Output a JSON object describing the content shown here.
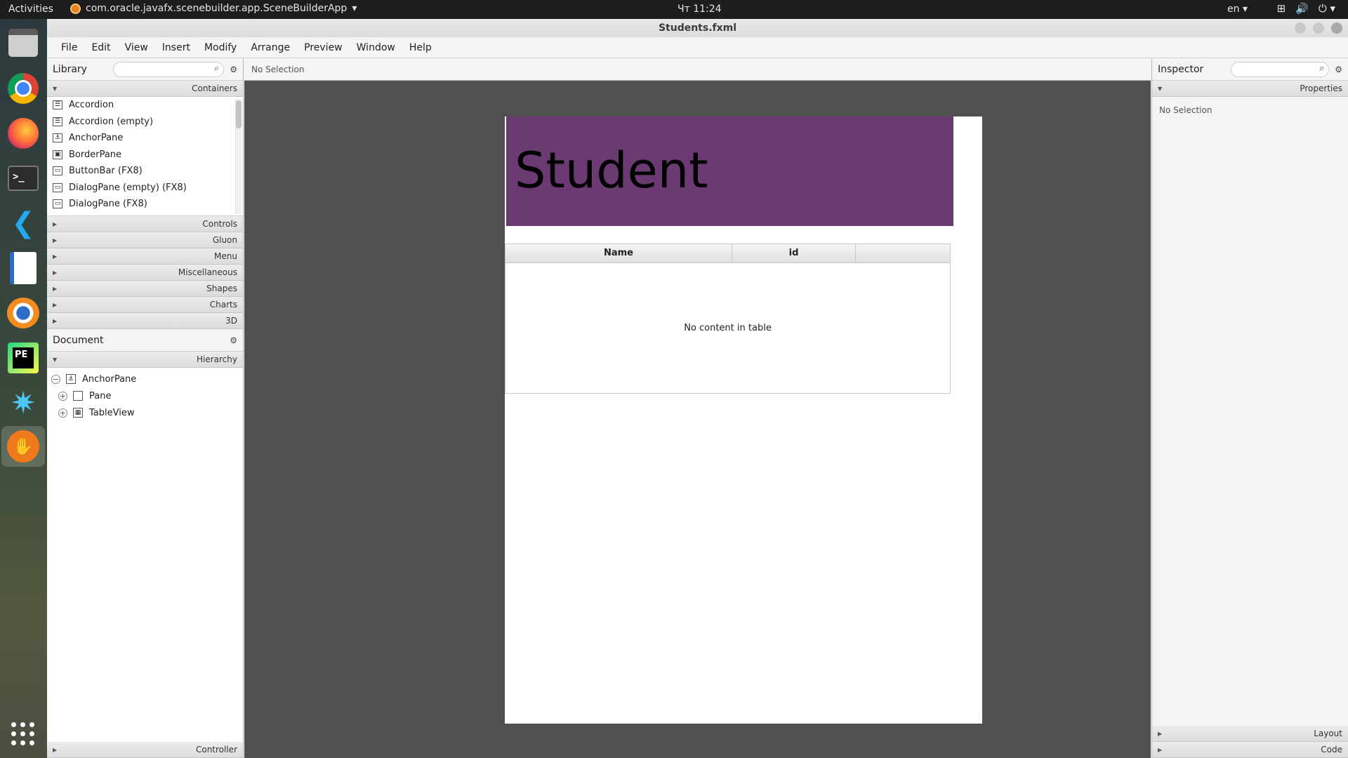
{
  "topbar": {
    "activities": "Activities",
    "app_name": "com.oracle.javafx.scenebuilder.app.SceneBuilderApp",
    "clock": "Чт 11:24",
    "language": "en"
  },
  "dock": {
    "items": [
      "files-icon",
      "chrome-icon",
      "firefox-icon",
      "terminal-icon",
      "vscode-icon",
      "writer-icon",
      "blender-icon",
      "pycharm-icon",
      "splash-icon",
      "scenebuilder-icon",
      "apps-grid-icon"
    ]
  },
  "window": {
    "title": "Students.fxml"
  },
  "menubar": [
    "File",
    "Edit",
    "View",
    "Insert",
    "Modify",
    "Arrange",
    "Preview",
    "Window",
    "Help"
  ],
  "library": {
    "title": "Library",
    "containers_label": "Containers",
    "items": [
      "Accordion",
      "Accordion  (empty)",
      "AnchorPane",
      "BorderPane",
      "ButtonBar  (FX8)",
      "DialogPane (empty)  (FX8)",
      "DialogPane  (FX8)"
    ],
    "sections": [
      "Controls",
      "Gluon",
      "Menu",
      "Miscellaneous",
      "Shapes",
      "Charts",
      "3D"
    ]
  },
  "document": {
    "title": "Document",
    "hierarchy_label": "Hierarchy",
    "tree": {
      "root": "AnchorPane",
      "children": [
        "Pane",
        "TableView"
      ]
    },
    "controller_label": "Controller"
  },
  "center": {
    "selection_text": "No Selection",
    "header_text": "Student",
    "table": {
      "columns": [
        "Name",
        "id"
      ],
      "placeholder": "No content in table"
    }
  },
  "inspector": {
    "title": "Inspector",
    "properties_label": "Properties",
    "selection_text": "No Selection",
    "layout_label": "Layout",
    "code_label": "Code"
  },
  "colors": {
    "header_pane": "#6b3a73",
    "canvas_bg": "#4f4f4f"
  }
}
